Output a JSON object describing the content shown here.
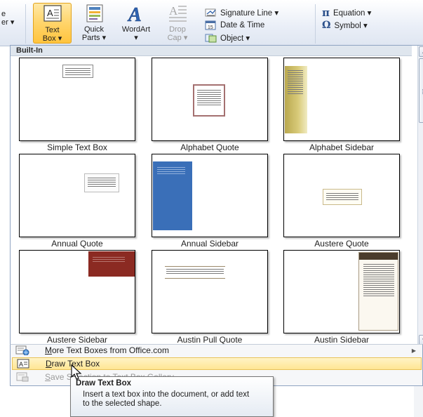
{
  "ribbon": {
    "partial_label_line1": "e",
    "partial_label_line2": "er ▾",
    "text_box": {
      "line1": "Text",
      "line2": "Box ▾"
    },
    "quick_parts": {
      "line1": "Quick",
      "line2": "Parts ▾"
    },
    "wordart": {
      "line1": "WordArt",
      "line2": "▾"
    },
    "drop_cap": {
      "line1": "Drop",
      "line2": "Cap ▾"
    },
    "signature_line": "Signature Line ▾",
    "date_time": "Date & Time",
    "object": "Object ▾",
    "equation": "Equation ▾",
    "symbol": "Symbol ▾"
  },
  "gallery": {
    "header": "Built-In",
    "tiles": [
      {
        "label": "Simple Text Box"
      },
      {
        "label": "Alphabet Quote"
      },
      {
        "label": "Alphabet Sidebar"
      },
      {
        "label": "Annual Quote"
      },
      {
        "label": "Annual Sidebar"
      },
      {
        "label": "Austere Quote"
      },
      {
        "label": "Austere Sidebar"
      },
      {
        "label": "Austin Pull Quote"
      },
      {
        "label": "Austin Sidebar"
      }
    ]
  },
  "menu": {
    "more_text_boxes": {
      "accel": "M",
      "rest": "ore Text Boxes from Office.com"
    },
    "draw_text_box": {
      "accel": "D",
      "rest": "raw Text Box"
    },
    "save_selection": {
      "accel": "S",
      "rest": "ave Selection to Text Box Gallery"
    }
  },
  "tooltip": {
    "title": "Draw Text Box",
    "body": "Insert a text box into the document, or add text to the selected shape."
  },
  "colors": {
    "accent_orange": "#ffc43e",
    "annual_blue": "#3a6fb8",
    "austere_red": "#8b2a22",
    "alphabet_gold": "#b9a84e",
    "austin_brown": "#4a3c2c"
  }
}
